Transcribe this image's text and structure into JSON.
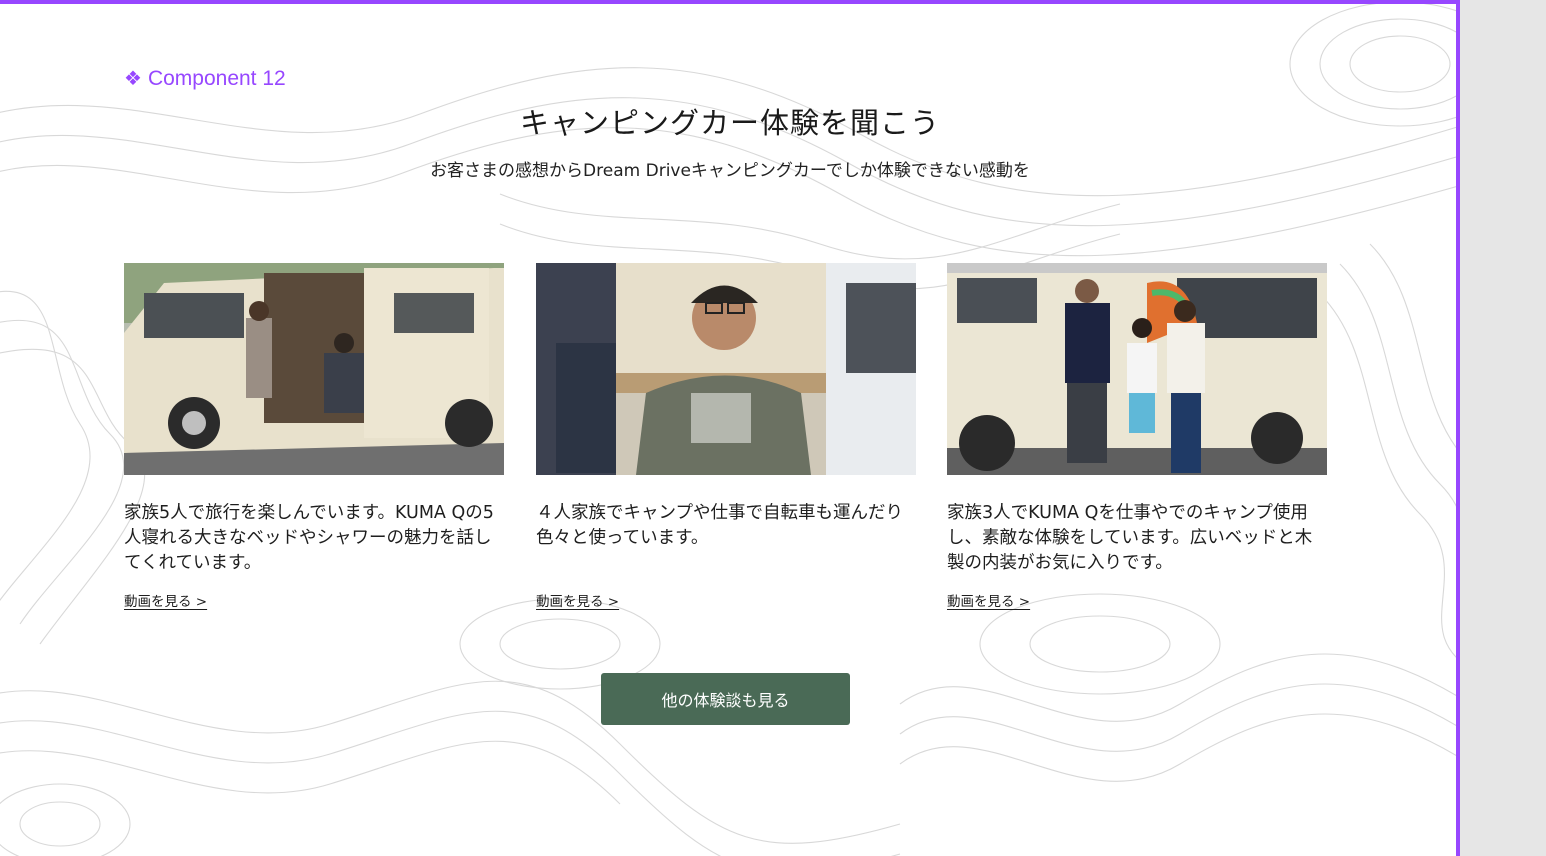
{
  "component": {
    "label": "Component 12",
    "icon": "component-diamond-icon"
  },
  "section": {
    "title": "キャンピングカー体験を聞こう",
    "subtitle": "お客さまの感想からDream Driveキャンピングカーでしか体験できない感動を"
  },
  "cards": [
    {
      "image": "family-of-five-at-camper-van-photo",
      "text": "家族5人で旅行を楽しんでいます。KUMA Qの5人寝れる大きなベッドやシャワーの魅力を話してくれています。",
      "link": "動画を見る >"
    },
    {
      "image": "man-in-camper-van-photo",
      "text": "４人家族でキャンプや仕事で自転車も運んだり色々と使っています。",
      "link": "動画を見る >"
    },
    {
      "image": "family-of-three-waving-photo",
      "text": "家族3人でKUMA Qを仕事やでのキャンプ使用し、素敵な体験をしています。広いベッドと木製の内装がお気に入りです。",
      "link": "動画を見る >"
    }
  ],
  "cta": {
    "label": "他の体験談も見る"
  },
  "colors": {
    "accent": "#9747ff",
    "button": "#4a6a56",
    "background": "#ffffff"
  }
}
